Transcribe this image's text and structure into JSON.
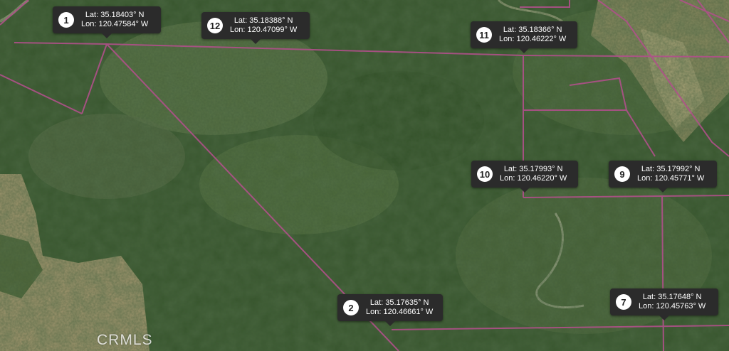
{
  "map": {
    "type": "satellite",
    "parcel_line_color": "#b0508a",
    "markers": [
      {
        "id": "m1",
        "number": "1",
        "lat": "Lat: 35.18403° N",
        "lon": "Lon: 120.47584° W"
      },
      {
        "id": "m12",
        "number": "12",
        "lat": "Lat: 35.18388° N",
        "lon": "Lon: 120.47099° W"
      },
      {
        "id": "m11",
        "number": "11",
        "lat": "Lat: 35.18366° N",
        "lon": "Lon: 120.46222° W"
      },
      {
        "id": "m10",
        "number": "10",
        "lat": "Lat: 35.17993° N",
        "lon": "Lon: 120.46220° W"
      },
      {
        "id": "m9",
        "number": "9",
        "lat": "Lat: 35.17992° N",
        "lon": "Lon: 120.45771° W"
      },
      {
        "id": "m2",
        "number": "2",
        "lat": "Lat: 35.17635° N",
        "lon": "Lon: 120.46661° W"
      },
      {
        "id": "m7",
        "number": "7",
        "lat": "Lat: 35.17648° N",
        "lon": "Lon: 120.45763° W"
      }
    ]
  },
  "watermark": "CRMLS"
}
